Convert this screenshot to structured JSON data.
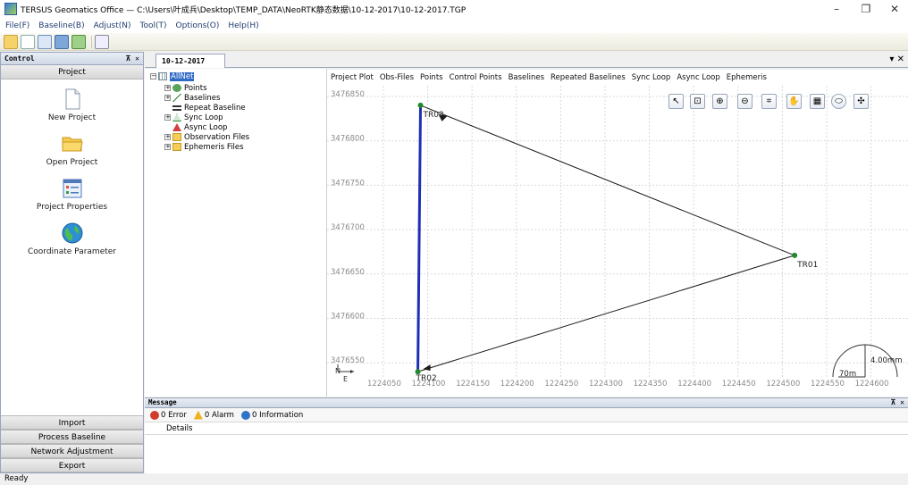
{
  "window": {
    "title": "TERSUS Geomatics Office — C:\\Users\\叶成兵\\Desktop\\TEMP_DATA\\NeoRTK静态数据\\10-12-2017\\10-12-2017.TGP",
    "minimize": "–",
    "maximize": "❐",
    "close": "✕"
  },
  "menu": [
    "File(F)",
    "Baseline(B)",
    "Adjust(N)",
    "Tool(T)",
    "Options(O)",
    "Help(H)"
  ],
  "control_panel": {
    "header": "Control",
    "pin": "⊼ ✕",
    "section_title": "Project",
    "items": [
      {
        "label": "New Project",
        "icon": "new-project-icon"
      },
      {
        "label": "Open Project",
        "icon": "open-folder-icon"
      },
      {
        "label": "Project Properties",
        "icon": "project-properties-icon"
      },
      {
        "label": "Coordinate Parameter",
        "icon": "globe-icon"
      }
    ],
    "bottom_sections": [
      "Import",
      "Process Baseline",
      "Network Adjustment",
      "Export"
    ]
  },
  "document": {
    "tab": "10-12-2017",
    "close": "▾ ✕"
  },
  "tree": {
    "root": "AllNet",
    "items": [
      "Points",
      "Baselines",
      "Repeat Baseline",
      "Sync Loop",
      "Async Loop",
      "Observation Files",
      "Ephemeris Files"
    ]
  },
  "plot_tabs": [
    "Project Plot",
    "Obs-Files",
    "Points",
    "Control Points",
    "Baselines",
    "Repeated Baselines",
    "Sync Loop",
    "Async Loop",
    "Ephemeris"
  ],
  "plot": {
    "y_ticks": [
      "3476850",
      "3476800",
      "3476750",
      "3476700",
      "3476650",
      "3476600",
      "3476550"
    ],
    "x_ticks": [
      "1224050",
      "1224100",
      "1224150",
      "1224200",
      "1224250",
      "1224300",
      "1224350",
      "1224400",
      "1224450",
      "1224500",
      "1224550",
      "1224600"
    ],
    "points": [
      {
        "name": "TR01",
        "x": 1224530,
        "y": 3476667
      },
      {
        "name": "TR02",
        "x": 1224105,
        "y": 3476536
      },
      {
        "name": "TR03",
        "x": 1224108,
        "y": 3476836
      }
    ],
    "north_label": "N",
    "east_label": "E",
    "scale_label": "4.00mm",
    "scale_distance": "70m",
    "colors": {
      "baseline": "#1a1a1a",
      "highlight": "#1f2fb5",
      "point": "#1f8a2a"
    }
  },
  "messages": {
    "header": "Message",
    "pin": "⊼ ✕",
    "error": "0 Error",
    "alarm": "0 Alarm",
    "info": "0 Information",
    "details_col": "Details"
  },
  "status": "Ready"
}
